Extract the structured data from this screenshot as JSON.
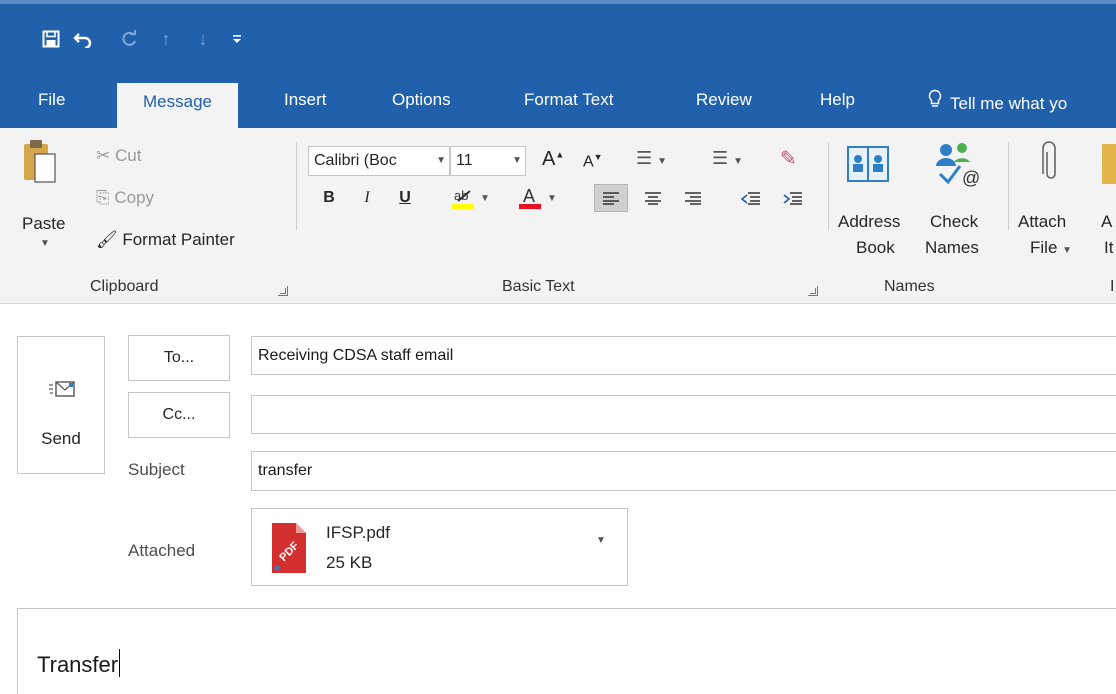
{
  "quick_access": {
    "save_icon": "save-icon",
    "undo_icon": "undo-icon",
    "redo_icon": "redo-icon",
    "up_icon": "arrow-up-icon",
    "down_icon": "arrow-down-icon",
    "customize_icon": "customize-qat-icon"
  },
  "tabs": [
    {
      "label": "File"
    },
    {
      "label": "Message",
      "active": true
    },
    {
      "label": "Insert"
    },
    {
      "label": "Options"
    },
    {
      "label": "Format Text"
    },
    {
      "label": "Review"
    },
    {
      "label": "Help"
    }
  ],
  "tell_me": {
    "label": "Tell me what yo"
  },
  "clipboard": {
    "paste": "Paste",
    "cut": "Cut",
    "copy": "Copy",
    "format_painter": "Format Painter",
    "group": "Clipboard"
  },
  "basic_text": {
    "font_name": "Calibri (Boc",
    "font_size": "11",
    "bold": "B",
    "italic": "I",
    "underline": "U",
    "group": "Basic Text"
  },
  "names": {
    "address_book_line1": "Address",
    "address_book_line2": "Book",
    "check_names_line1": "Check",
    "check_names_line2": "Names",
    "group": "Names"
  },
  "include": {
    "attach_file_line1": "Attach",
    "attach_file_line2": "File",
    "attach_item_line1": "A",
    "attach_item_line2": "It",
    "group_fragment": "I"
  },
  "compose": {
    "send_label": "Send",
    "to_button": "To...",
    "cc_button": "Cc...",
    "to_value": "Receiving CDSA staff email",
    "cc_value": "",
    "subject_label": "Subject",
    "subject_value": "transfer",
    "attached_label": "Attached"
  },
  "attachment": {
    "name": "IFSP.pdf",
    "size": "25 KB",
    "icon": "pdf-icon",
    "badge": "PDF"
  },
  "body": {
    "text": "Transfer"
  },
  "colors": {
    "title_bar": "#2160ab",
    "ribbon": "#f3f3f3",
    "highlight_yellow": "#ffff00",
    "font_color_red": "#e81123"
  }
}
